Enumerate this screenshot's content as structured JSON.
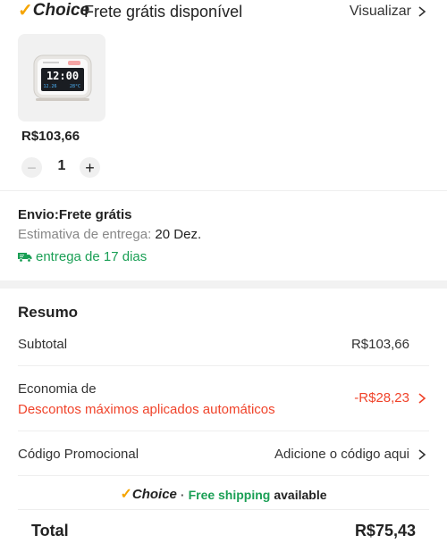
{
  "header": {
    "choice_brand": "Choice",
    "title": "Frete grátis disponível",
    "view_label": "Visualizar"
  },
  "product": {
    "image_icon": "alarm-clock-product-image",
    "price": "R$103,66",
    "quantity": "1",
    "minus_symbol": "−",
    "plus_symbol": "+"
  },
  "shipping": {
    "title": "Envio:Frete grátis",
    "estimate_label": "Estimativa de entrega:",
    "estimate_date": "20 Dez.",
    "delivery_text": "entrega de 17 dias"
  },
  "summary": {
    "title": "Resumo",
    "subtotal_label": "Subtotal",
    "subtotal_value": "R$103,66",
    "savings_label": "Economia de",
    "savings_sub": "Descontos máximos aplicados automáticos",
    "savings_value": "-R$28,23",
    "promo_label": "Código Promocional",
    "promo_value": "Adicione o código aqui"
  },
  "banner": {
    "choice_brand": "Choice",
    "separator": "·",
    "free_shipping": "Free shipping",
    "available": "available"
  },
  "total": {
    "label": "Total",
    "value": "R$75,43"
  },
  "colors": {
    "accent_orange": "#f5a400",
    "discount_red": "#f0432a",
    "shipping_green": "#1a9f55"
  }
}
